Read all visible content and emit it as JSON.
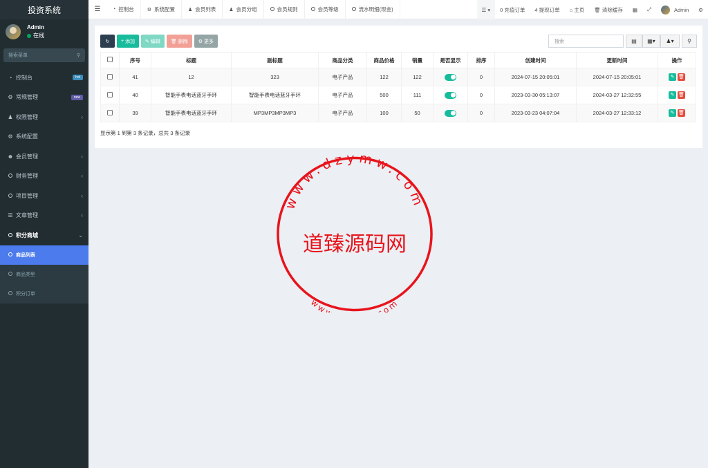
{
  "app": {
    "title": "投资系统"
  },
  "user": {
    "name": "Admin",
    "status": "在线"
  },
  "sidebar": {
    "search_placeholder": "搜索菜单",
    "items": [
      {
        "label": "控制台",
        "icon": "dashboard-icon",
        "badge": "hot"
      },
      {
        "label": "常规管理",
        "icon": "cogs-icon",
        "badge": "new"
      },
      {
        "label": "权限管理",
        "icon": "group-icon",
        "arrow": "‹"
      },
      {
        "label": "系统配置",
        "icon": "gear-icon"
      },
      {
        "label": "会员管理",
        "icon": "user-circle-icon",
        "arrow": "‹"
      },
      {
        "label": "财务管理",
        "icon": "circle-icon",
        "arrow": "‹"
      },
      {
        "label": "项目管理",
        "icon": "circle-icon",
        "arrow": "‹"
      },
      {
        "label": "文章管理",
        "icon": "list-icon",
        "arrow": "‹"
      },
      {
        "label": "积分商城",
        "icon": "circle-icon",
        "arrow": "⌄"
      }
    ],
    "submenu": [
      "商品列表",
      "商品类型",
      "积分订单"
    ]
  },
  "topbar": {
    "tabs": [
      {
        "label": "控制台",
        "icon": "dashboard-icon"
      },
      {
        "label": "系统配置",
        "icon": "gear-icon"
      },
      {
        "label": "会员列表",
        "icon": "user-icon"
      },
      {
        "label": "会员分组",
        "icon": "group-icon"
      },
      {
        "label": "会员规则",
        "icon": "circle-icon"
      },
      {
        "label": "会员等级",
        "icon": "circle-icon"
      },
      {
        "label": "流水明细(现金)",
        "icon": "circle-icon"
      }
    ],
    "recharge": "0 充值订单",
    "withdraw": "4 提现订单",
    "home": "主页",
    "clear_cache": "清除缓存",
    "admin": "Admin"
  },
  "toolbar": {
    "add": "添加",
    "edit": "编辑",
    "delete": "删除",
    "more": "更多",
    "search_placeholder": "搜索"
  },
  "table": {
    "headers": [
      "序号",
      "标题",
      "副标题",
      "商品分类",
      "商品价格",
      "销量",
      "是否显示",
      "排序",
      "创建时间",
      "更新时间",
      "操作"
    ],
    "rows": [
      {
        "id": "41",
        "title": "12",
        "subtitle": "323",
        "category": "电子产品",
        "price": "122",
        "sales": "122",
        "sort": "0",
        "created": "2024-07-15 20:05:01",
        "updated": "2024-07-15 20:05:01"
      },
      {
        "id": "40",
        "title": "智能手表电话蓝牙手环",
        "subtitle": "智能手表电话蓝牙手环",
        "category": "电子产品",
        "price": "500",
        "sales": "111",
        "sort": "0",
        "created": "2023-03-30 05:13:07",
        "updated": "2024-03-27 12:32:55"
      },
      {
        "id": "39",
        "title": "智能手表电话蓝牙手环",
        "subtitle": "MP3MP3MP3MP3",
        "category": "电子产品",
        "price": "100",
        "sales": "50",
        "sort": "0",
        "created": "2023-03-23 04:07:04",
        "updated": "2024-03-27 12:33:12"
      }
    ],
    "footer": "显示第 1 到第 3 条记录，总共 3 条记录"
  },
  "watermark": {
    "name": "道臻源码网",
    "url_top": "www.dzymw.com",
    "url_bottom": "www.dzymw.com"
  },
  "colors": {
    "accent": "#18bc9c",
    "sidebar": "#222d32",
    "active": "#4b7bec",
    "danger": "#e74c3c",
    "stamp": "#e8141c"
  }
}
